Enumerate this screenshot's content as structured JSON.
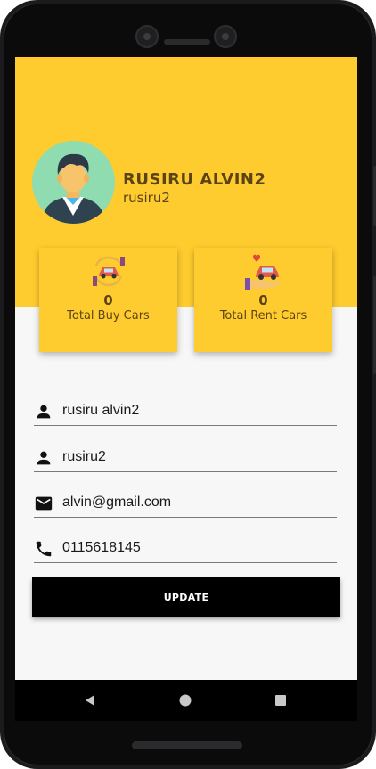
{
  "profile": {
    "full_name": "RUSIRU ALVIN2",
    "username": "rusiru2"
  },
  "stats": {
    "buy": {
      "count": "0",
      "label": "Total Buy Cars"
    },
    "rent": {
      "count": "0",
      "label": "Total Rent Cars"
    }
  },
  "form": {
    "name_value": "rusiru alvin2",
    "username_value": "rusiru2",
    "email_value": "alvin@gmail.com",
    "phone_value": "0115618145",
    "update_label": "UPDATE"
  },
  "navbar": {
    "back": "back-icon",
    "home": "home-icon",
    "recents": "recents-icon"
  },
  "colors": {
    "accent": "#fecc2e",
    "text_brown": "#5b4314",
    "button": "#000000"
  }
}
